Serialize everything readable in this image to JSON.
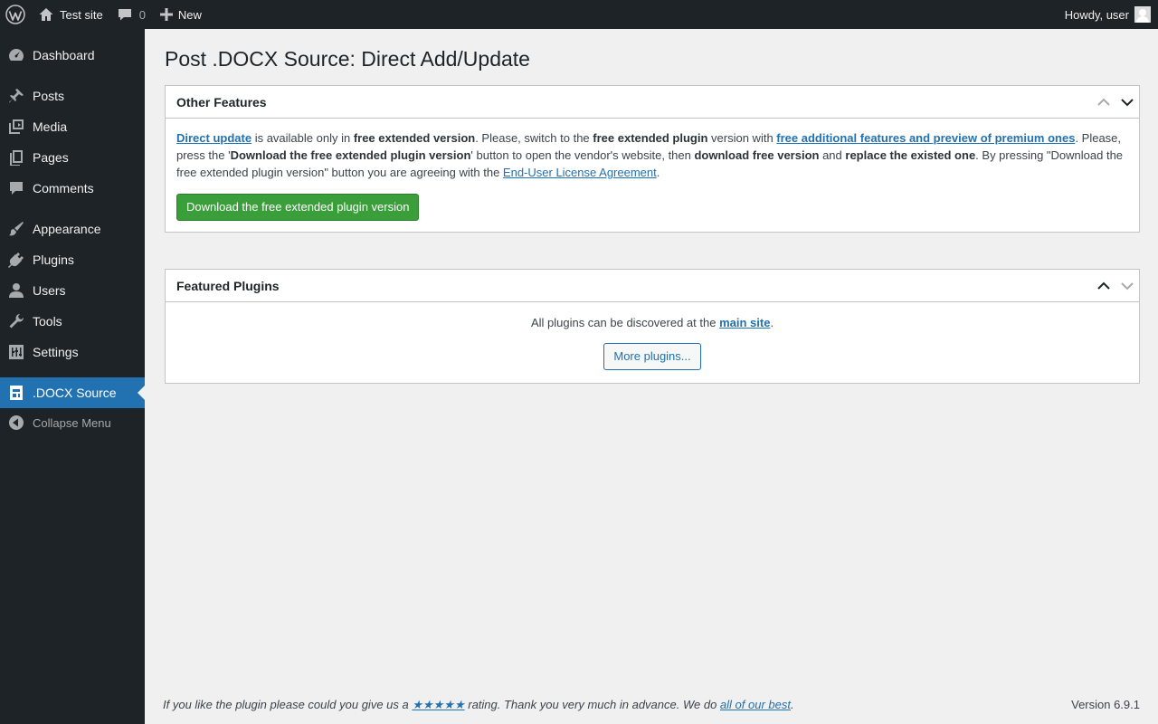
{
  "adminbar": {
    "site_name": "Test site",
    "comments_count": "0",
    "new_label": "New",
    "greeting": "Howdy, user"
  },
  "sidebar": {
    "items": [
      {
        "label": "Dashboard",
        "icon": "dashboard-icon"
      },
      {
        "label": "Posts",
        "icon": "pin-icon"
      },
      {
        "label": "Media",
        "icon": "media-icon"
      },
      {
        "label": "Pages",
        "icon": "pages-icon"
      },
      {
        "label": "Comments",
        "icon": "comment-icon"
      },
      {
        "label": "Appearance",
        "icon": "brush-icon"
      },
      {
        "label": "Plugins",
        "icon": "plugin-icon"
      },
      {
        "label": "Users",
        "icon": "user-icon"
      },
      {
        "label": "Tools",
        "icon": "wrench-icon"
      },
      {
        "label": "Settings",
        "icon": "sliders-icon"
      },
      {
        "label": ".DOCX Source",
        "icon": "docx-icon"
      }
    ],
    "collapse_label": "Collapse Menu"
  },
  "page": {
    "title": "Post .DOCX Source: Direct Add/Update"
  },
  "other_features": {
    "title": "Other Features",
    "link_direct_update": "Direct update",
    "t1": " is available only in ",
    "b1": "free extended version",
    "t2": ". Please, switch to the ",
    "b2": "free extended plugin",
    "t3": " version with ",
    "link_features": "free additional features and preview of premium ones",
    "t4": ". Please, press the '",
    "b3": "Download the free extended plugin version",
    "t5": "' button to open the vendor's website, then ",
    "b4": "download free version",
    "t6": " and ",
    "b5": "replace the existed one",
    "t7": ". By pressing \"Download the free extended plugin version\" button you are agreeing with the ",
    "link_eula": "End-User License Agreement",
    "t8": ".",
    "button_label": "Download the free extended plugin version"
  },
  "featured_plugins": {
    "title": "Featured Plugins",
    "t1": "All plugins can be discovered at the ",
    "link_main_site": "main site",
    "t2": ".",
    "button_label": "More plugins..."
  },
  "footer": {
    "t1": "If you like the plugin please could you give us a ",
    "stars": "★★★★★",
    "t2": " rating. Thank you very much in advance. We do ",
    "link_best": "all of our best",
    "t3": ".",
    "version": "Version 6.9.1"
  },
  "colors": {
    "adminbar_bg": "#1d2327",
    "accent": "#2271b1",
    "download_button": "#3a9e3a",
    "content_bg": "#f0f0f1"
  }
}
